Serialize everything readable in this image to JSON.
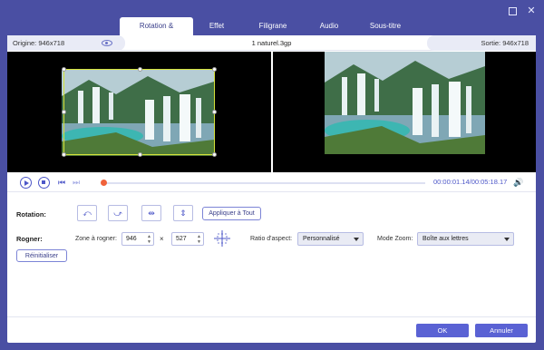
{
  "tabs": [
    {
      "label": "Rotation & Rognage",
      "active": true
    },
    {
      "label": "Effet",
      "active": false
    },
    {
      "label": "Filigrane",
      "active": false
    },
    {
      "label": "Audio",
      "active": false
    },
    {
      "label": "Sous-titre",
      "active": false
    }
  ],
  "window": {
    "minimize_icon": "minimize-icon",
    "maximize_icon": "maximize-icon",
    "close_icon": "close-icon"
  },
  "info": {
    "original": "Origine: 946x718",
    "filename": "1 naturel.3gp",
    "output": "Sortie: 946x718"
  },
  "player": {
    "current_time": "00:00:01.14",
    "total_time": "/00:05:18.17",
    "progress": 0.01
  },
  "rotation": {
    "label": "Rotation:",
    "apply_all": "Appliquer à Tout",
    "buttons": [
      "rotate-left-icon",
      "rotate-right-icon",
      "flip-horizontal-icon",
      "flip-vertical-icon"
    ]
  },
  "crop": {
    "label": "Rogner:",
    "zone_label": "Zone à rogner:",
    "width": "946",
    "height": "527",
    "times": "×",
    "aspect_label": "Ratio d'aspect:",
    "aspect_value": "Personnalisé",
    "zoom_label": "Mode Zoom:",
    "zoom_value": "Boîte aux lettres",
    "reset": "Réinitialiser"
  },
  "footer": {
    "ok": "OK",
    "cancel": "Annuler"
  },
  "colors": {
    "accent": "#4a4fa3",
    "button": "#5a62d4",
    "crop_border": "#d6e23a",
    "playhead": "#f0623a"
  }
}
